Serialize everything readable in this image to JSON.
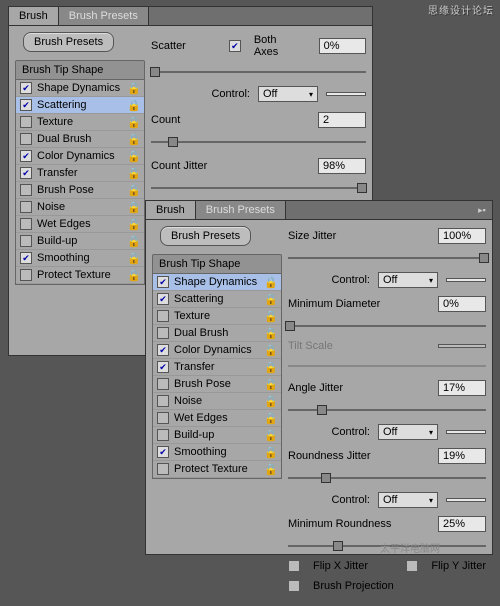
{
  "watermark1": "思缘设计论坛",
  "watermark2": "太平洋电脑网",
  "panel1": {
    "tabs": [
      "Brush",
      "Brush Presets"
    ],
    "presets_btn": "Brush Presets",
    "list_header": "Brush Tip Shape",
    "items": [
      {
        "label": "Shape Dynamics",
        "checked": true,
        "selected": false
      },
      {
        "label": "Scattering",
        "checked": true,
        "selected": true
      },
      {
        "label": "Texture",
        "checked": false,
        "selected": false
      },
      {
        "label": "Dual Brush",
        "checked": false,
        "selected": false
      },
      {
        "label": "Color Dynamics",
        "checked": true,
        "selected": false
      },
      {
        "label": "Transfer",
        "checked": true,
        "selected": false
      },
      {
        "label": "Brush Pose",
        "checked": false,
        "selected": false
      },
      {
        "label": "Noise",
        "checked": false,
        "selected": false
      },
      {
        "label": "Wet Edges",
        "checked": false,
        "selected": false
      },
      {
        "label": "Build-up",
        "checked": false,
        "selected": false
      },
      {
        "label": "Smoothing",
        "checked": true,
        "selected": false
      },
      {
        "label": "Protect Texture",
        "checked": false,
        "selected": false
      }
    ],
    "scatter_label": "Scatter",
    "both_axes": "Both Axes",
    "both_axes_checked": true,
    "scatter_value": "0%",
    "control_label": "Control:",
    "control_value": "Off",
    "count_label": "Count",
    "count_value": "2",
    "count_jitter_label": "Count Jitter",
    "count_jitter_value": "98%"
  },
  "panel2": {
    "tabs": [
      "Brush",
      "Brush Presets"
    ],
    "presets_btn": "Brush Presets",
    "list_header": "Brush Tip Shape",
    "items": [
      {
        "label": "Shape Dynamics",
        "checked": true,
        "selected": true
      },
      {
        "label": "Scattering",
        "checked": true,
        "selected": false
      },
      {
        "label": "Texture",
        "checked": false,
        "selected": false
      },
      {
        "label": "Dual Brush",
        "checked": false,
        "selected": false
      },
      {
        "label": "Color Dynamics",
        "checked": true,
        "selected": false
      },
      {
        "label": "Transfer",
        "checked": true,
        "selected": false
      },
      {
        "label": "Brush Pose",
        "checked": false,
        "selected": false
      },
      {
        "label": "Noise",
        "checked": false,
        "selected": false
      },
      {
        "label": "Wet Edges",
        "checked": false,
        "selected": false
      },
      {
        "label": "Build-up",
        "checked": false,
        "selected": false
      },
      {
        "label": "Smoothing",
        "checked": true,
        "selected": false
      },
      {
        "label": "Protect Texture",
        "checked": false,
        "selected": false
      }
    ],
    "size_jitter_label": "Size Jitter",
    "size_jitter_value": "100%",
    "control_label": "Control:",
    "control_value": "Off",
    "min_diam_label": "Minimum Diameter",
    "min_diam_value": "0%",
    "tilt_label": "Tilt Scale",
    "angle_jitter_label": "Angle Jitter",
    "angle_jitter_value": "17%",
    "roundness_jitter_label": "Roundness Jitter",
    "roundness_jitter_value": "19%",
    "min_roundness_label": "Minimum Roundness",
    "min_roundness_value": "25%",
    "flip_x": "Flip X Jitter",
    "flip_y": "Flip Y Jitter",
    "brush_proj": "Brush Projection"
  }
}
